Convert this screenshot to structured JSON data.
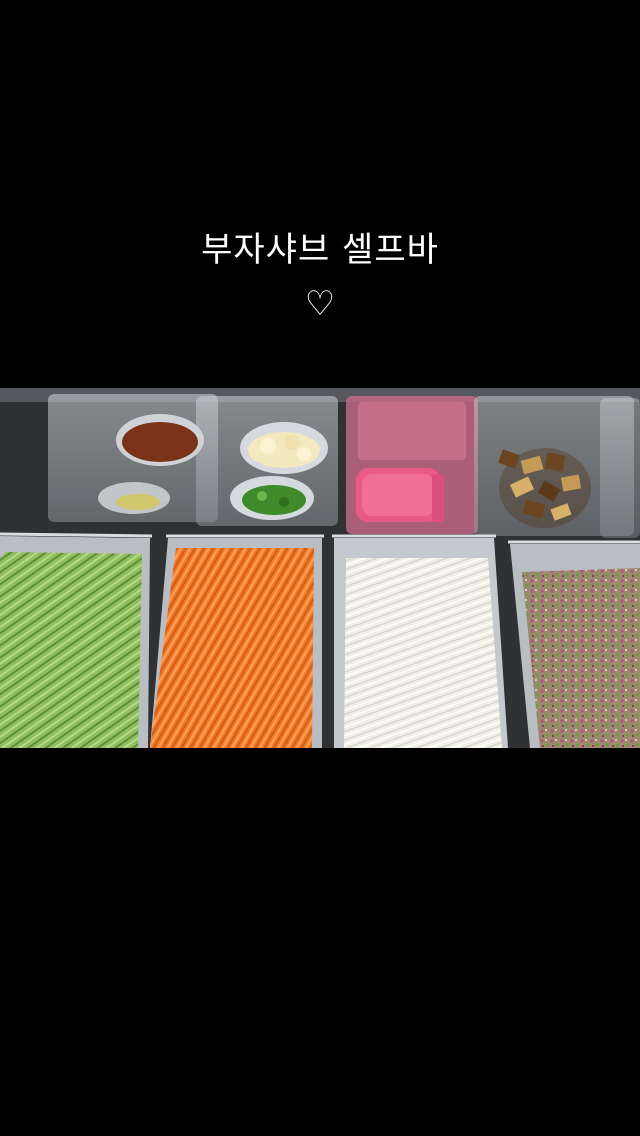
{
  "caption": {
    "title": "부자샤브 셀프바",
    "heart": "♡"
  },
  "photo": {
    "icon": "salad-bar-photo",
    "colors": {
      "background": "#000000",
      "counter": "#2a2c2e",
      "tray_steel": "#b9bec3",
      "cucumber": "#7fae4f",
      "carrot": "#f07a2a",
      "cabbage": "#f1efe7",
      "sprouts": "#b8527a",
      "radish": "#ea5a86",
      "sauce": "#7a3218",
      "garlic": "#f3e9bf",
      "pepper": "#3f8a2a",
      "pickle": "#6b4520"
    }
  }
}
